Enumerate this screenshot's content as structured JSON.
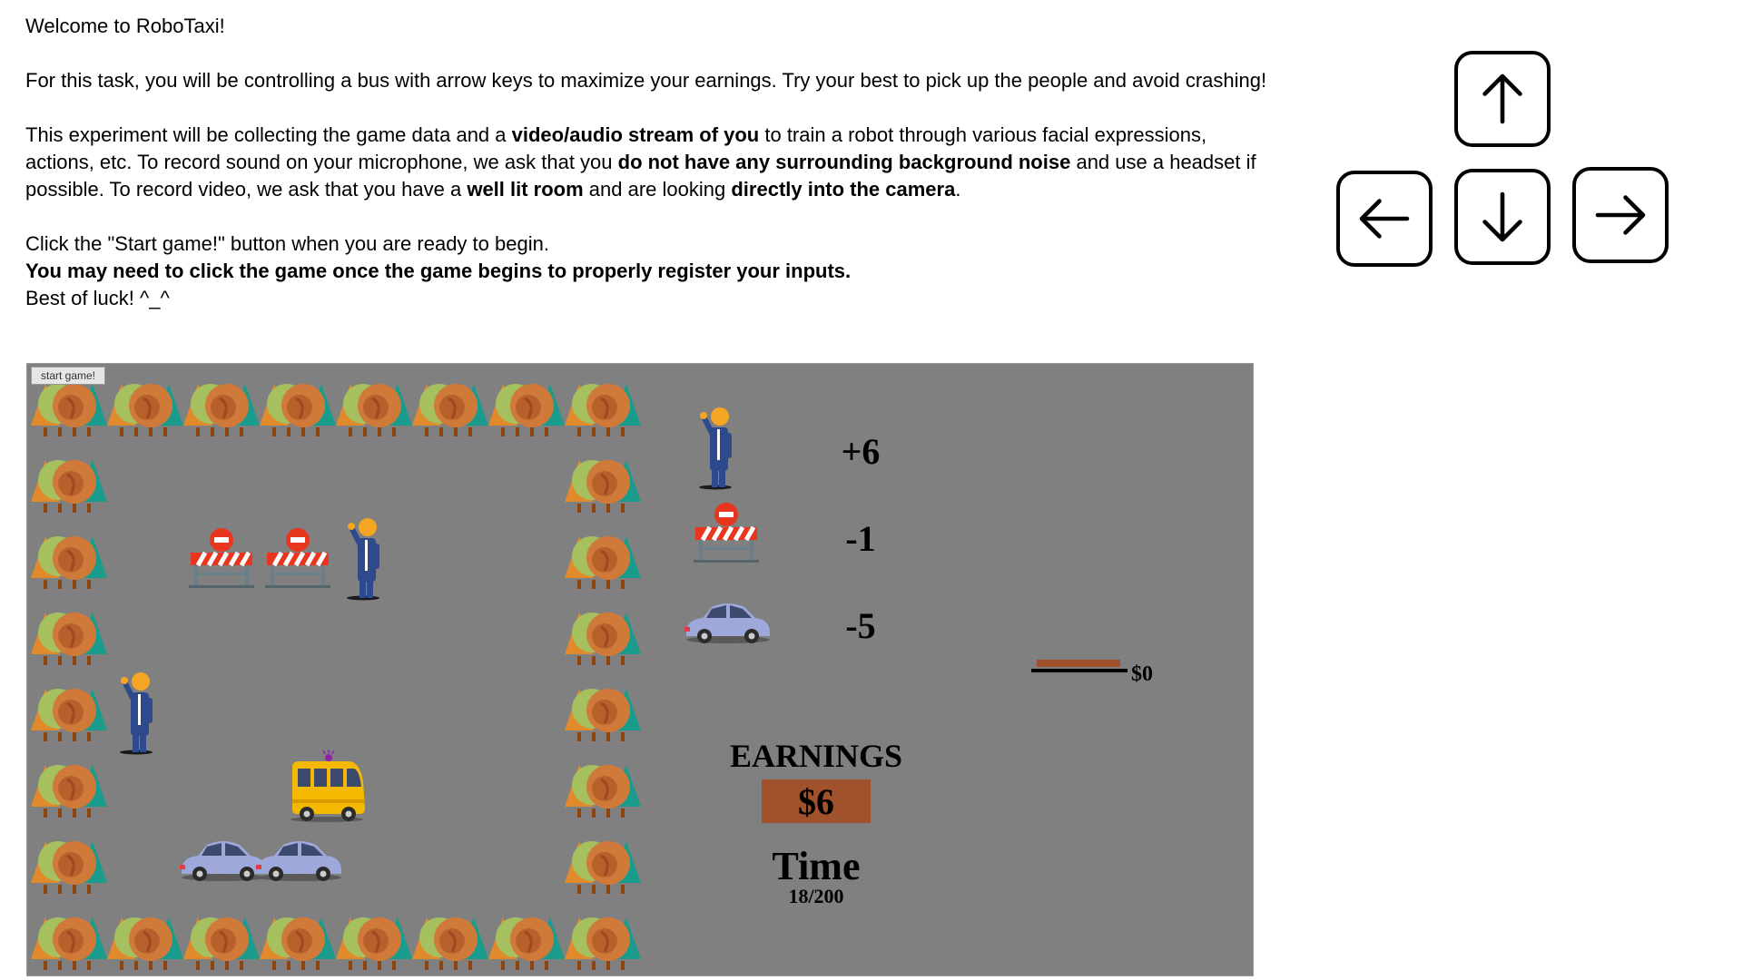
{
  "intro": {
    "welcome": "Welcome to RoboTaxi!",
    "task": "For this task, you will be controlling a bus with arrow keys to maximize your earnings. Try your best to pick up the people and avoid crashing!",
    "record": {
      "t1": "This experiment will be collecting the game data and a ",
      "b1": "video/audio stream of you",
      "t2": " to train a robot through various facial expressions, actions, etc. To record sound on your microphone, we ask that you ",
      "b2": "do not have any surrounding background noise",
      "t3": " and use a headset if possible. To record video, we ask that you have a ",
      "b3": "well lit room",
      "t4": " and are looking ",
      "b4": "directly into the camera",
      "t5": "."
    },
    "start_hint": "Click the \"Start game!\" button when you are ready to begin.",
    "click_note": "You may need to click the game once the game begins to properly register your inputs.",
    "luck": "Best of luck! ^_^"
  },
  "controls": {
    "keys": [
      {
        "name": "up-arrow-key",
        "icon": "arrow-up-icon"
      },
      {
        "name": "left-arrow-key",
        "icon": "arrow-left-icon"
      },
      {
        "name": "down-arrow-key",
        "icon": "arrow-down-icon"
      },
      {
        "name": "right-arrow-key",
        "icon": "arrow-right-icon"
      }
    ]
  },
  "game": {
    "start_button": "start game!",
    "legend": [
      {
        "icon": "passenger-icon",
        "value": "+6"
      },
      {
        "icon": "roadblock-icon",
        "value": "-1"
      },
      {
        "icon": "car-icon",
        "value": "-5"
      }
    ],
    "bar_label": "$0",
    "earnings_label": "EARNINGS",
    "earnings_value": "$6",
    "time_label": "Time",
    "time_value": "18/200",
    "colors": {
      "board": "#808080",
      "earnings_box": "#a0522d",
      "passenger_suit": "#2c4a8c",
      "passenger_head": "#f5a623",
      "car": "#9fa8da",
      "bus": "#f5b800",
      "barrier": "#e8351e"
    }
  }
}
